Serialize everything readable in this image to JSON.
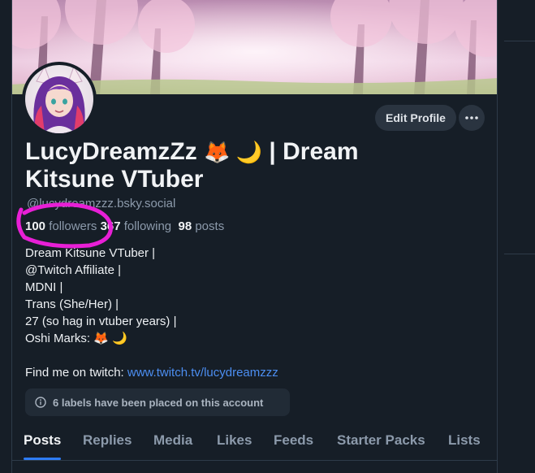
{
  "profile": {
    "display_name_line1": "LucyDreamzZz",
    "display_name_emojis": "🦊 🌙",
    "display_name_rest": "| Dream",
    "display_name_line2": "Kitsune VTuber",
    "handle": "@lucydreamzzz.bsky.social",
    "edit_profile_label": "Edit Profile",
    "more_label": "···"
  },
  "stats": {
    "followers_count": "100",
    "followers_label": "followers",
    "following_count": "367",
    "following_label": "following",
    "posts_count": "98",
    "posts_label": "posts"
  },
  "bio": {
    "lines": [
      "Dream Kitsune VTuber |",
      "@Twitch Affiliate |",
      "MDNI |",
      "Trans (She/Her) |",
      "27 (so hag in vtuber years) |",
      "Oshi Marks: 🦊 🌙"
    ],
    "link_prefix": "Find me on twitch: ",
    "link_text": "www.twitch.tv/lucydreamzzz"
  },
  "labels_notice": {
    "icon": "info-icon",
    "text": "6 labels have been placed on this account"
  },
  "tabs": [
    {
      "label": "Posts",
      "active": true
    },
    {
      "label": "Replies",
      "active": false
    },
    {
      "label": "Media",
      "active": false
    },
    {
      "label": "Likes",
      "active": false
    },
    {
      "label": "Feeds",
      "active": false
    },
    {
      "label": "Starter Packs",
      "active": false
    },
    {
      "label": "Lists",
      "active": false
    }
  ],
  "colors": {
    "background": "#161e27",
    "accent": "#2e7cf6",
    "link": "#4c8ef1",
    "annotation_circle": "#e81fd6"
  }
}
